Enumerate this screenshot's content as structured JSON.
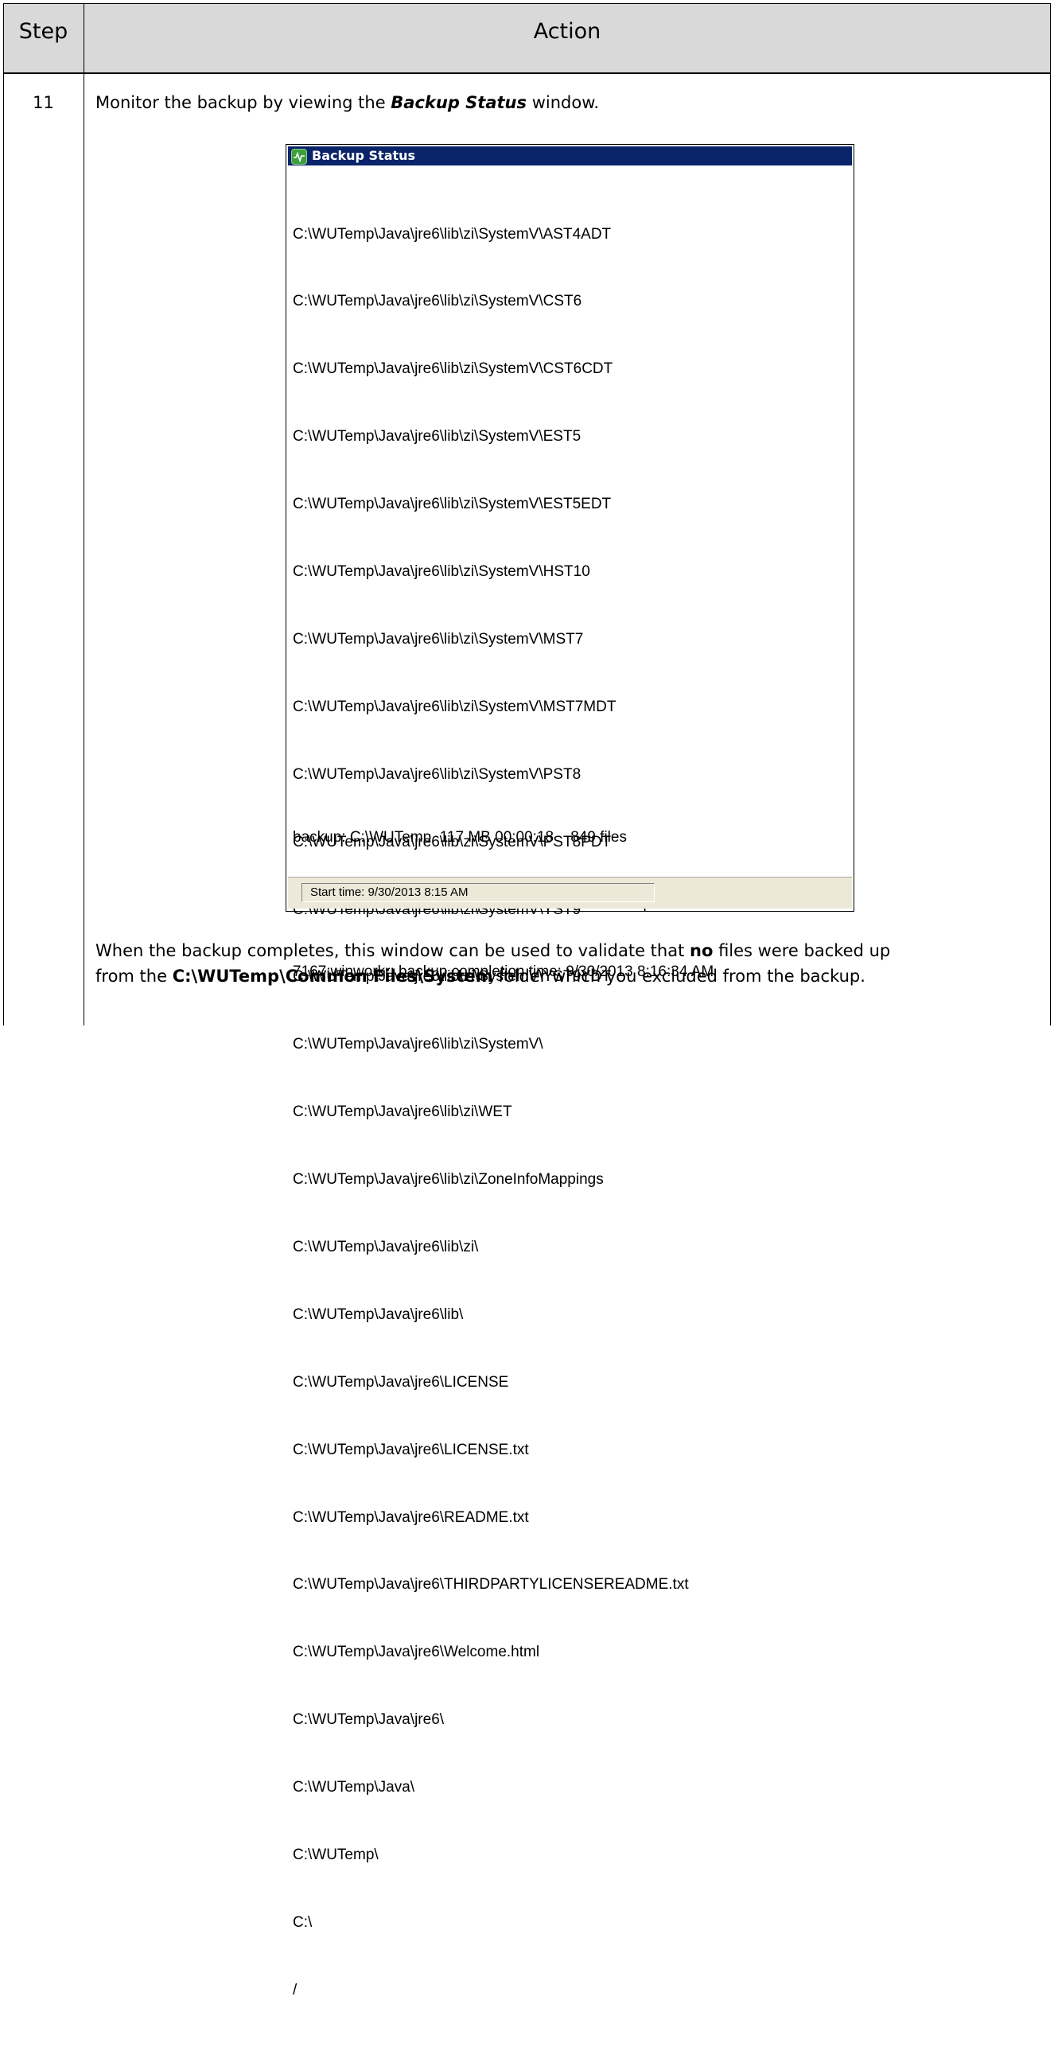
{
  "table": {
    "header_step": "Step",
    "header_action": "Action",
    "step_number": "11"
  },
  "intro": {
    "before": "Monitor the backup by viewing the ",
    "emphasis": "Backup Status",
    "after": " window."
  },
  "window": {
    "title": "Backup Status",
    "log_lines": [
      "C:\\WUTemp\\Java\\jre6\\lib\\zi\\SystemV\\AST4ADT",
      "C:\\WUTemp\\Java\\jre6\\lib\\zi\\SystemV\\CST6",
      "C:\\WUTemp\\Java\\jre6\\lib\\zi\\SystemV\\CST6CDT",
      "C:\\WUTemp\\Java\\jre6\\lib\\zi\\SystemV\\EST5",
      "C:\\WUTemp\\Java\\jre6\\lib\\zi\\SystemV\\EST5EDT",
      "C:\\WUTemp\\Java\\jre6\\lib\\zi\\SystemV\\HST10",
      "C:\\WUTemp\\Java\\jre6\\lib\\zi\\SystemV\\MST7",
      "C:\\WUTemp\\Java\\jre6\\lib\\zi\\SystemV\\MST7MDT",
      "C:\\WUTemp\\Java\\jre6\\lib\\zi\\SystemV\\PST8",
      "C:\\WUTemp\\Java\\jre6\\lib\\zi\\SystemV\\PST8PDT",
      "C:\\WUTemp\\Java\\jre6\\lib\\zi\\SystemV\\YST9",
      "C:\\WUTemp\\Java\\jre6\\lib\\zi\\SystemV\\YST9YDT",
      "C:\\WUTemp\\Java\\jre6\\lib\\zi\\SystemV\\",
      "C:\\WUTemp\\Java\\jre6\\lib\\zi\\WET",
      "C:\\WUTemp\\Java\\jre6\\lib\\zi\\ZoneInfoMappings",
      "C:\\WUTemp\\Java\\jre6\\lib\\zi\\",
      "C:\\WUTemp\\Java\\jre6\\lib\\",
      "C:\\WUTemp\\Java\\jre6\\LICENSE",
      "C:\\WUTemp\\Java\\jre6\\LICENSE.txt",
      "C:\\WUTemp\\Java\\jre6\\README.txt",
      "C:\\WUTemp\\Java\\jre6\\THIRDPARTYLICENSEREADME.txt",
      "C:\\WUTemp\\Java\\jre6\\Welcome.html",
      "C:\\WUTemp\\Java\\jre6\\",
      "C:\\WUTemp\\Java\\",
      "C:\\WUTemp\\",
      "C:\\",
      "/"
    ],
    "summary_lines": [
      "backup: C:\\WUTemp  117 MB 00:00:18    849 files",
      "94694:winworkr: The backup of save set 'C:\\WUTemp' succeeded.",
      "7167:winworkr: backup completion time: 9/30/2013 8:16:34 AM"
    ],
    "status_text": "Start time: 9/30/2013 8:15 AM",
    "icon": "backup-status-icon"
  },
  "outro": {
    "p1": "When the backup completes, this window can be used to validate that ",
    "b1": "no",
    "p2": " files were backed up",
    "p3": "from the ",
    "b2": "C:\\WUTemp\\Common Files\\System",
    "p4": " folder which you excluded from the backup."
  }
}
